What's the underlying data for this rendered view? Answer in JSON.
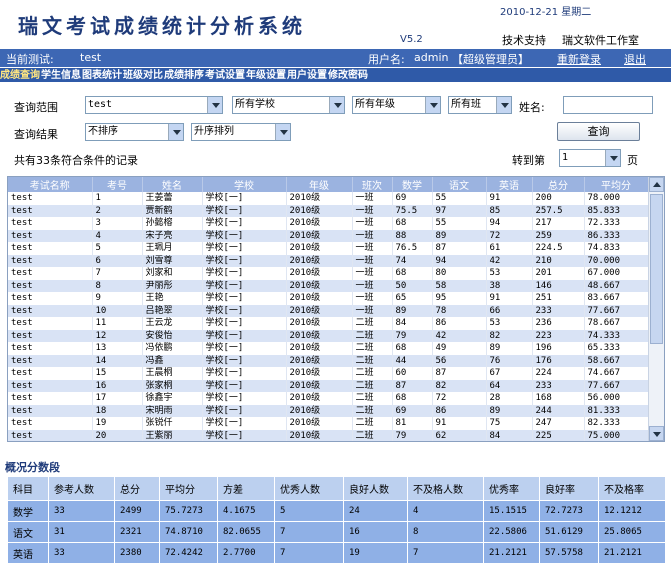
{
  "header": {
    "title": "瑞文考试成绩统计分析系统",
    "date": "2010-12-21 星期二",
    "version": "V5.2",
    "support": "技术支持",
    "studio": "瑞文软件工作室"
  },
  "status": {
    "exam_label": "当前测试:",
    "exam_value": "test",
    "user_label": "用户名:",
    "user_value": "admin",
    "role": "【超级管理员】",
    "relogin": "重新登录",
    "logout": "退出"
  },
  "menu": [
    "成绩查询",
    "学生信息",
    "图表统计",
    "班级对比",
    "成绩排序",
    "考试设置",
    "年级设置",
    "用户设置",
    "修改密码"
  ],
  "query": {
    "range_label": "查询范围",
    "exam_select": "test",
    "school_select": "所有学校",
    "grade_select": "所有年级",
    "class_select": "所有班",
    "name_label": "姓名:",
    "result_label": "查询结果",
    "sort_select": "不排序",
    "order_select": "升序排列",
    "button": "查询",
    "count_text": "共有33条符合条件的记录",
    "goto_label": "转到第",
    "page_value": "1",
    "page_unit": "页"
  },
  "results": {
    "columns": [
      "考试名称",
      "考号",
      "姓名",
      "学校",
      "年级",
      "班次",
      "数学",
      "语文",
      "英语",
      "总分",
      "平均分"
    ],
    "rows": [
      [
        "test",
        "1",
        "王姜蕾",
        "学校[一]",
        "2010级",
        "一班",
        "69",
        "55",
        "91",
        "200",
        "78.000"
      ],
      [
        "test",
        "2",
        "贾新鹤",
        "学校[一]",
        "2010级",
        "一班",
        "75.5",
        "97",
        "85",
        "257.5",
        "85.833"
      ],
      [
        "test",
        "3",
        "孙懿榕",
        "学校[一]",
        "2010级",
        "一班",
        "68",
        "55",
        "94",
        "217",
        "72.333"
      ],
      [
        "test",
        "4",
        "宋子亮",
        "学校[一]",
        "2010级",
        "一班",
        "88",
        "89",
        "72",
        "259",
        "86.333"
      ],
      [
        "test",
        "5",
        "王珮月",
        "学校[一]",
        "2010级",
        "一班",
        "76.5",
        "87",
        "61",
        "224.5",
        "74.833"
      ],
      [
        "test",
        "6",
        "刘雪尊",
        "学校[一]",
        "2010级",
        "一班",
        "74",
        "94",
        "42",
        "210",
        "70.000"
      ],
      [
        "test",
        "7",
        "刘家和",
        "学校[一]",
        "2010级",
        "一班",
        "68",
        "80",
        "53",
        "201",
        "67.000"
      ],
      [
        "test",
        "8",
        "尹丽彤",
        "学校[一]",
        "2010级",
        "一班",
        "50",
        "58",
        "38",
        "146",
        "48.667"
      ],
      [
        "test",
        "9",
        "王艳",
        "学校[一]",
        "2010级",
        "一班",
        "65",
        "95",
        "91",
        "251",
        "83.667"
      ],
      [
        "test",
        "10",
        "吕艳翠",
        "学校[一]",
        "2010级",
        "一班",
        "89",
        "78",
        "66",
        "233",
        "77.667"
      ],
      [
        "test",
        "11",
        "王云龙",
        "学校[一]",
        "2010级",
        "二班",
        "84",
        "86",
        "53",
        "236",
        "78.667"
      ],
      [
        "test",
        "12",
        "安俊怡",
        "学校[一]",
        "2010级",
        "二班",
        "79",
        "42",
        "82",
        "223",
        "74.333"
      ],
      [
        "test",
        "13",
        "冯依鹏",
        "学校[一]",
        "2010级",
        "二班",
        "68",
        "49",
        "89",
        "196",
        "65.333"
      ],
      [
        "test",
        "14",
        "冯鑫",
        "学校[一]",
        "2010级",
        "二班",
        "44",
        "56",
        "76",
        "176",
        "58.667"
      ],
      [
        "test",
        "15",
        "王晨桐",
        "学校[一]",
        "2010级",
        "二班",
        "60",
        "87",
        "67",
        "224",
        "74.667"
      ],
      [
        "test",
        "16",
        "张家桐",
        "学校[一]",
        "2010级",
        "二班",
        "87",
        "82",
        "64",
        "233",
        "77.667"
      ],
      [
        "test",
        "17",
        "徐鑫宇",
        "学校[一]",
        "2010级",
        "二班",
        "68",
        "72",
        "28",
        "168",
        "56.000"
      ],
      [
        "test",
        "18",
        "宋明雨",
        "学校[一]",
        "2010级",
        "二班",
        "69",
        "86",
        "89",
        "244",
        "81.333"
      ],
      [
        "test",
        "19",
        "张锐仟",
        "学校[一]",
        "2010级",
        "二班",
        "81",
        "91",
        "75",
        "247",
        "82.333"
      ],
      [
        "test",
        "20",
        "王紫丽",
        "学校[一]",
        "2010级",
        "二班",
        "79",
        "62",
        "84",
        "225",
        "75.000"
      ]
    ]
  },
  "summary": {
    "title": "概况分数段",
    "columns": [
      "科目",
      "参考人数",
      "总分",
      "平均分",
      "方差",
      "优秀人数",
      "良好人数",
      "不及格人数",
      "优秀率",
      "良好率",
      "不及格率"
    ],
    "rows": [
      [
        "数学",
        "33",
        "2499",
        "75.7273",
        "4.1675",
        "5",
        "24",
        "4",
        "15.1515",
        "72.7273",
        "12.1212"
      ],
      [
        "语文",
        "31",
        "2321",
        "74.8710",
        "82.0655",
        "7",
        "16",
        "8",
        "22.5806",
        "51.6129",
        "25.8065"
      ],
      [
        "英语",
        "33",
        "2380",
        "72.4242",
        "2.7700",
        "7",
        "19",
        "7",
        "21.2121",
        "57.5758",
        "21.2121"
      ]
    ]
  }
}
